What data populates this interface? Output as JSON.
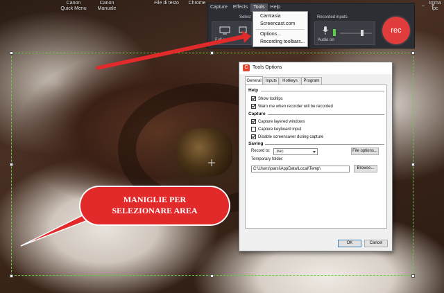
{
  "desktop": {
    "icons": [
      {
        "label": "Canon Quick Menu"
      },
      {
        "label": "Canon Manuale"
      },
      {
        "label": "File di testo"
      },
      {
        "label": "Chrome"
      },
      {
        "label": "Imma Ipc"
      }
    ]
  },
  "recorder": {
    "menu": [
      "Capture",
      "Effects",
      "Tools",
      "Help"
    ],
    "active_menu": "Tools",
    "select_area_label": "Select",
    "full_screen_label": "Full sc",
    "recorded_inputs_label": "Recorded inputs",
    "audio_label": "Audio on",
    "rec_label": "rec",
    "rec_color": "#e03c3c"
  },
  "tools_dropdown": {
    "items": [
      "Camtasia",
      "Screencast.com",
      "Options...",
      "Recording toolbars..."
    ]
  },
  "dialog": {
    "title": "Tools Options",
    "tabs": [
      "General",
      "Inputs",
      "Hotkeys",
      "Program"
    ],
    "active_tab": "General",
    "help": {
      "label": "Help",
      "show_tooltips": "Show tooltips",
      "warn_recorder": "Warn me when recorder will be recorded"
    },
    "capture": {
      "label": "Capture",
      "layered_windows": "Capture layered windows",
      "keyboard_input": "Capture keyboard input",
      "disable_screensaver": "Disable screensaver during capture"
    },
    "saving": {
      "label": "Saving",
      "record_to_label": "Record to:",
      "record_to_value": ".trec",
      "file_options_button": "File options...",
      "temp_folder_label": "Temporary folder:",
      "temp_folder_value": "C:\\Users\\parsi\\AppData\\Local\\Temp\\",
      "browse_button": "Browse..."
    },
    "ok_button": "OK",
    "cancel_button": "Cancel"
  },
  "annotation": {
    "line1": "MANIGLIE PER",
    "line2": "SELEZIONARE AREA",
    "callout_color": "#e22a2a",
    "arrow_color": "#e22a2a"
  },
  "selection": {
    "border_color": "#66cc44"
  }
}
